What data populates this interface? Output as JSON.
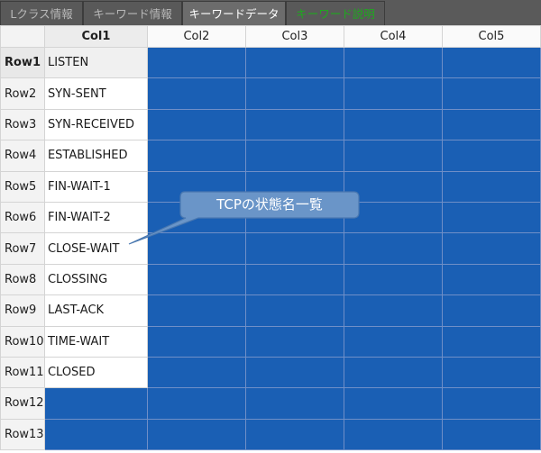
{
  "tabs": [
    {
      "label": "Lクラス情報"
    },
    {
      "label": "キーワード情報"
    },
    {
      "label": "キーワードデータ"
    },
    {
      "label": "キーワード説明"
    }
  ],
  "grid": {
    "columns": [
      "Col1",
      "Col2",
      "Col3",
      "Col4",
      "Col5"
    ],
    "rows": [
      {
        "label": "Row1",
        "col1": "LISTEN"
      },
      {
        "label": "Row2",
        "col1": "SYN-SENT"
      },
      {
        "label": "Row3",
        "col1": "SYN-RECEIVED"
      },
      {
        "label": "Row4",
        "col1": "ESTABLISHED"
      },
      {
        "label": "Row5",
        "col1": "FIN-WAIT-1"
      },
      {
        "label": "Row6",
        "col1": "FIN-WAIT-2"
      },
      {
        "label": "Row7",
        "col1": "CLOSE-WAIT"
      },
      {
        "label": "Row8",
        "col1": "CLOSSING"
      },
      {
        "label": "Row9",
        "col1": "LAST-ACK"
      },
      {
        "label": "Row10",
        "col1": "TIME-WAIT"
      },
      {
        "label": "Row11",
        "col1": "CLOSED"
      },
      {
        "label": "Row12",
        "col1": ""
      },
      {
        "label": "Row13",
        "col1": ""
      }
    ]
  },
  "callout": {
    "text": "TCPの状態名一覧"
  },
  "colors": {
    "tab_bar": "#5a5a5a",
    "active_tab": "#6c6c6c",
    "highlight_green": "#1fa81f",
    "cell_blue": "#1a5fb4",
    "callout_fill": "#6a95c8",
    "callout_stroke": "#4a78b0"
  }
}
